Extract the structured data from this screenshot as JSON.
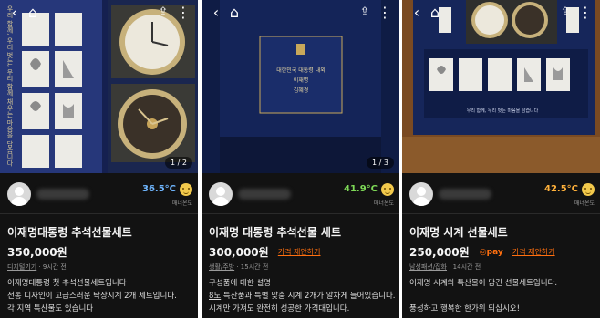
{
  "listings": [
    {
      "photo_counter": "1 / 2",
      "temperature": "36.5°C",
      "temperature_color": "#6fb6ff",
      "manner_label": "매너온도",
      "title": "이재명대통령 추석선물세트",
      "price": "350,000원",
      "category": "디지털기기",
      "time": " · 9시간 전",
      "description": [
        "이재명대통령 첫 추석선물세트입니다",
        "전통 디자인이 고급스러운 탁상시계 2개 세트입니다.",
        "각 지역 특산물도 있습니다"
      ]
    },
    {
      "photo_counter": "1 / 3",
      "temperature": "41.9°C",
      "temperature_color": "#7ed957",
      "manner_label": "매너온도",
      "title": "이재명 대통령 추석선물 세트",
      "price": "300,000원",
      "offer_label": "가격 제안하기",
      "category": "생활/주방",
      "time": " · 15시간 전",
      "description_line1": "구성품에 대한 설명",
      "description_line2_u": "8도",
      "description_line2": " 특산품과 특별 맞춤 시계 2개가 알차게 들어있습니다.",
      "description_line3": "시계만 가져도 완전히 성공한 가격대입니다."
    },
    {
      "temperature": "42.5°C",
      "temperature_color": "#ffb13b",
      "manner_label": "매너온도",
      "title": "이재명 시계 선물세트",
      "price": "250,000원",
      "pay_label": "pay",
      "offer_label": "가격 제안하기",
      "category": "남성패션/잡화",
      "time": " · 14시간 전",
      "description": [
        "이재명 시계와 특산물이 담긴 선물세트입니다.",
        "",
        "풍성하고 행복한 한가위 되십시오!"
      ]
    }
  ],
  "photo_texts": {
    "vertical_text_1": "우리 함께, 우리 벗는, 우리 함께 채우는 마음을 담습니다",
    "card_line1": "대한민국 대통령 내외",
    "card_line2": "이재명",
    "card_line3": "김혜경",
    "footer_text_3": "우리 함께, 우리 벗는 마음을 담습니다"
  }
}
